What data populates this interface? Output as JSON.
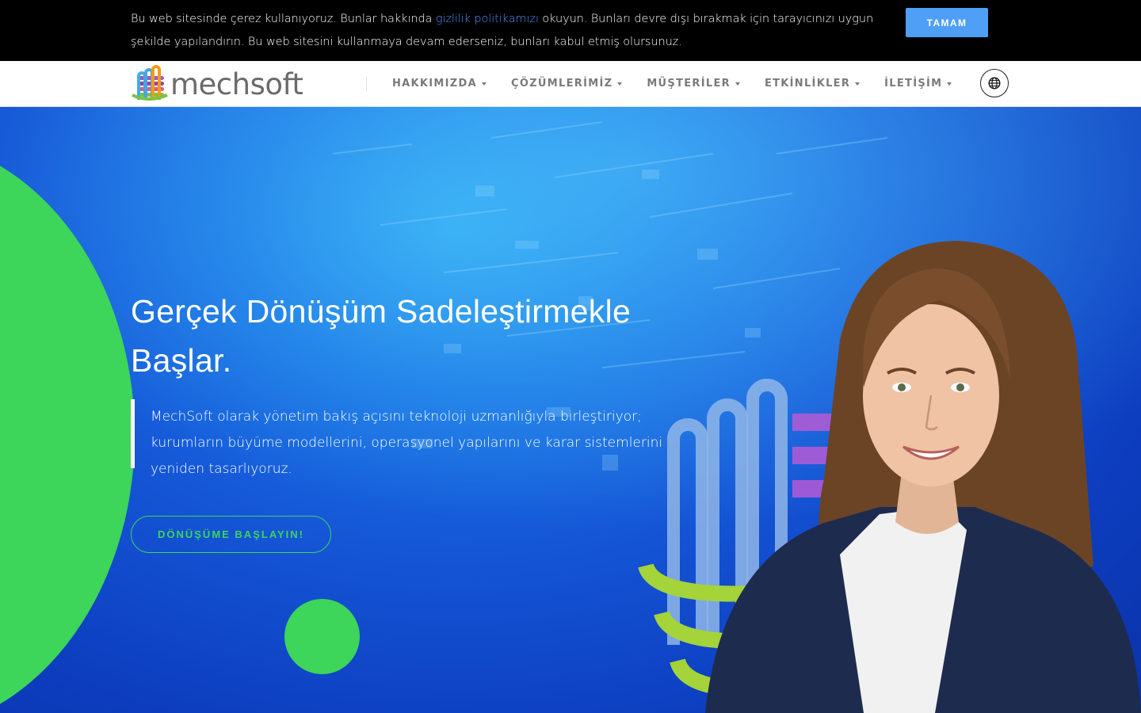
{
  "cookie": {
    "text_before": "Bu web sitesinde çerez kullanıyoruz. Bunlar hakkında ",
    "link_text": "gizlilik politikamızı",
    "text_after": " okuyun. Bunları devre dışı bırakmak için tarayıcınızı uygun şekilde yapılandırın. Bu web sitesini kullanmaya devam ederseniz, bunları kabul etmiş olursunuz.",
    "accept_label": "TAMAM"
  },
  "nav": {
    "logo_text": "mechsoft",
    "items": [
      {
        "label": "HAKKIMIZDA"
      },
      {
        "label": "ÇÖZÜMLERİMİZ"
      },
      {
        "label": "MÜŞTERİLER"
      },
      {
        "label": "ETKİNLİKLER"
      },
      {
        "label": "İLETİŞİM"
      }
    ],
    "language_icon": "globe-icon"
  },
  "hero": {
    "title": "Gerçek Dönüşüm Sadeleştirmekle Başlar.",
    "description": "MechSoft olarak yönetim bakış açısını teknoloji uzmanlığıyla birleştiriyor; kurumların büyüme modellerini, operasyonel yapılarını ve karar sistemlerini yeniden tasarlıyoruz.",
    "cta_label": "DÖNÜŞÜME BAŞLAYIN!"
  },
  "colors": {
    "accent_green": "#3dd55a",
    "cookie_button": "#4f9ff7",
    "link_blue": "#4d90fe",
    "hero_blue": "#1558d8"
  }
}
